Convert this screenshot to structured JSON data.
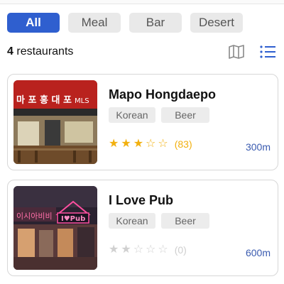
{
  "filters": {
    "items": [
      {
        "label": "All",
        "active": true
      },
      {
        "label": "Meal",
        "active": false
      },
      {
        "label": "Bar",
        "active": false
      },
      {
        "label": "Desert",
        "active": false
      }
    ]
  },
  "results": {
    "count": "4",
    "label": "restaurants"
  },
  "view_toggle": {
    "map_icon": "map-icon",
    "list_icon": "list-icon",
    "active_color": "#2f5fcf"
  },
  "restaurants": [
    {
      "name": "Mapo Hongdaepo",
      "tags": [
        "Korean",
        "Beer"
      ],
      "rating": 3,
      "rating_max": 5,
      "reviews": "(83)",
      "distance": "300m",
      "sign_text": "마 포 홍 대 포",
      "sign_brand": "MLS"
    },
    {
      "name": "I Love Pub",
      "tags": [
        "Korean",
        "Beer"
      ],
      "rating": 0,
      "rating_max": 5,
      "reviews": "(0)",
      "distance": "600m",
      "sign_text": "이시아비비",
      "sign_brand": "I♥Pub"
    }
  ],
  "colors": {
    "accent": "#2f5fcf",
    "star": "#f2b00e",
    "distance": "#3a5bb0"
  }
}
